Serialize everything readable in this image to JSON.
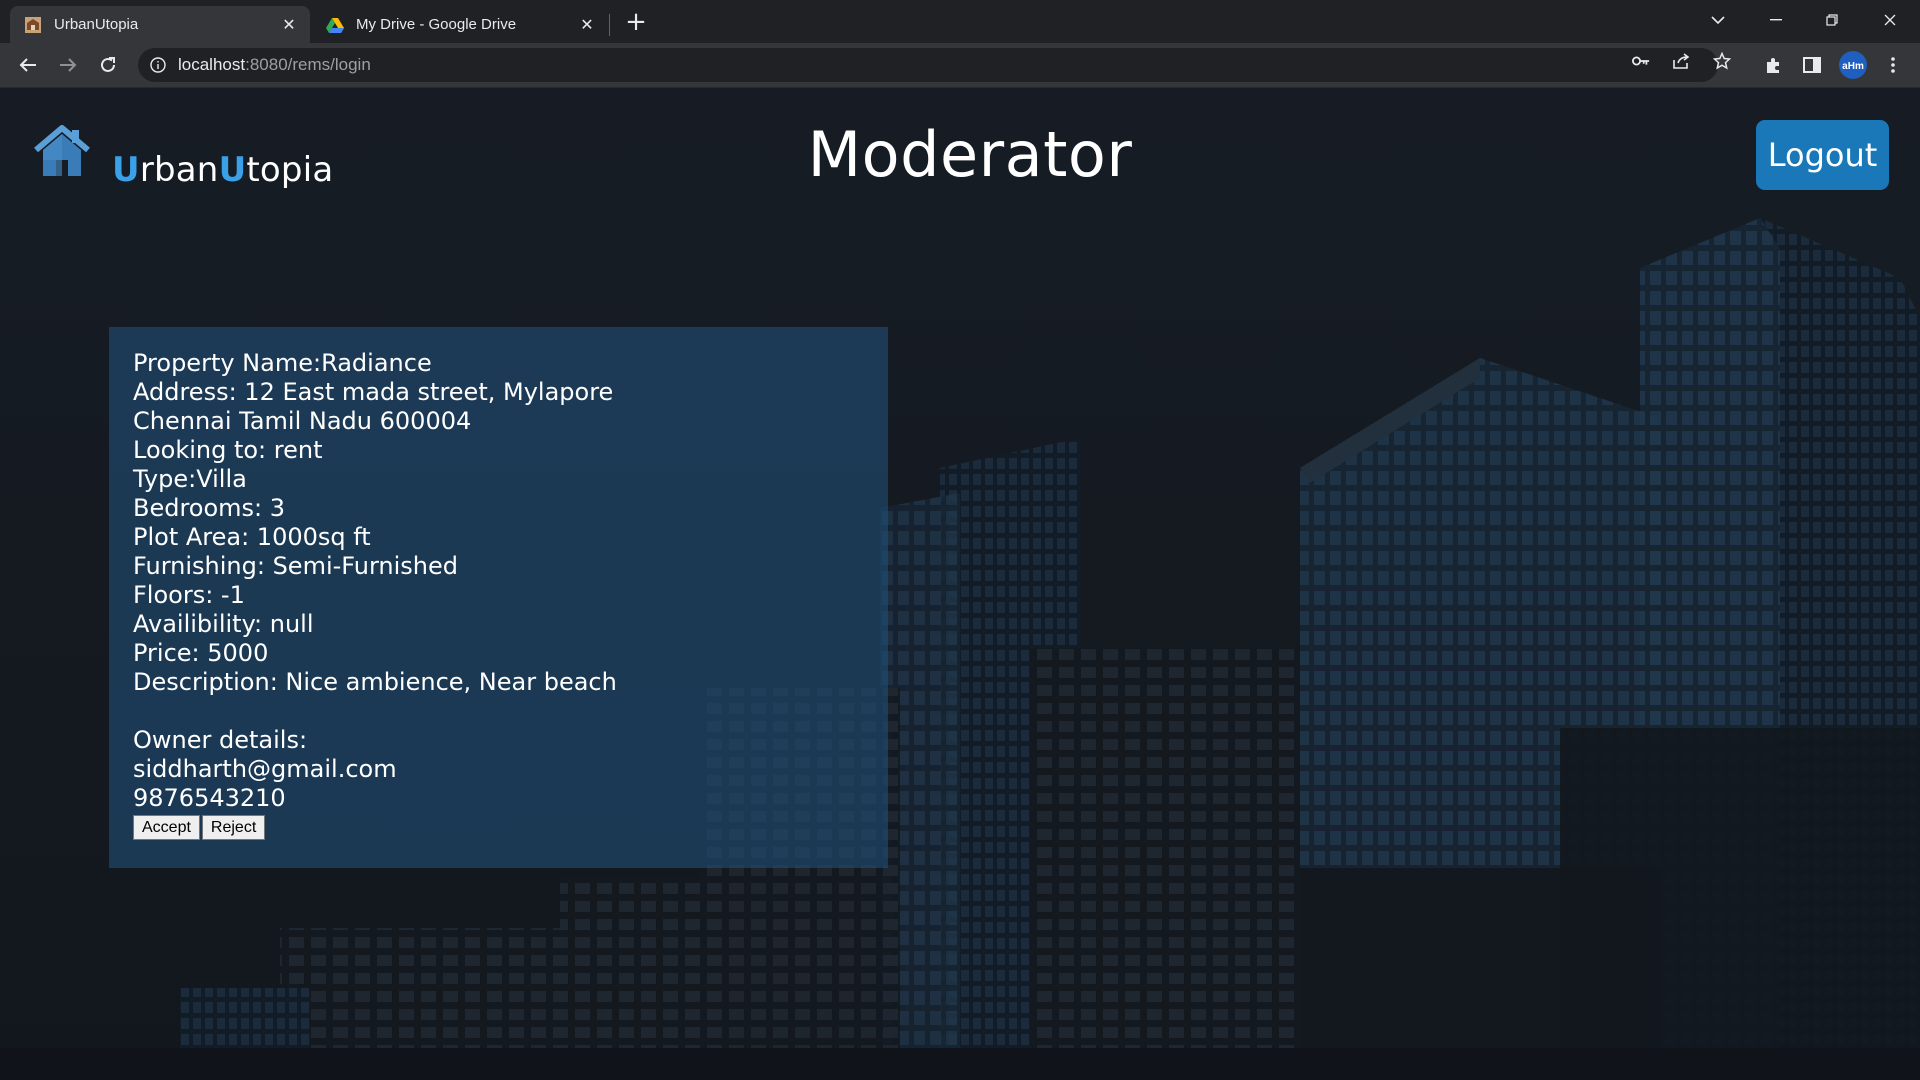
{
  "browser": {
    "tabs": [
      {
        "title": "UrbanUtopia",
        "active": true,
        "icon": "urbanutopia-favicon"
      },
      {
        "title": "My Drive - Google Drive",
        "active": false,
        "icon": "google-drive-icon"
      }
    ],
    "url": {
      "host": "localhost",
      "path": ":8080/rems/login"
    }
  },
  "header": {
    "brand_part1": "U",
    "brand_part2": "rban",
    "brand_part3": "U",
    "brand_part4": "topia",
    "title": "Moderator",
    "logout_label": "Logout"
  },
  "property": {
    "lines": [
      "Property Name:Radiance",
      "Address: 12 East mada street, Mylapore",
      "Chennai Tamil Nadu 600004",
      "Looking to: rent",
      "Type:Villa",
      "Bedrooms: 3",
      "Plot Area: 1000sq ft",
      "Furnishing: Semi-Furnished",
      "Floors: -1",
      "Availibility: null",
      "Price: 5000",
      "Description: Nice ambience, Near beach"
    ],
    "owner_heading": "Owner details:",
    "owner_email": "siddharth@gmail.com",
    "owner_phone": "9876543210",
    "accept_label": "Accept",
    "reject_label": "Reject"
  },
  "colors": {
    "accent": "#3aa0e8",
    "logout_bg": "#1a78b8",
    "card_bg": "#214e75"
  }
}
